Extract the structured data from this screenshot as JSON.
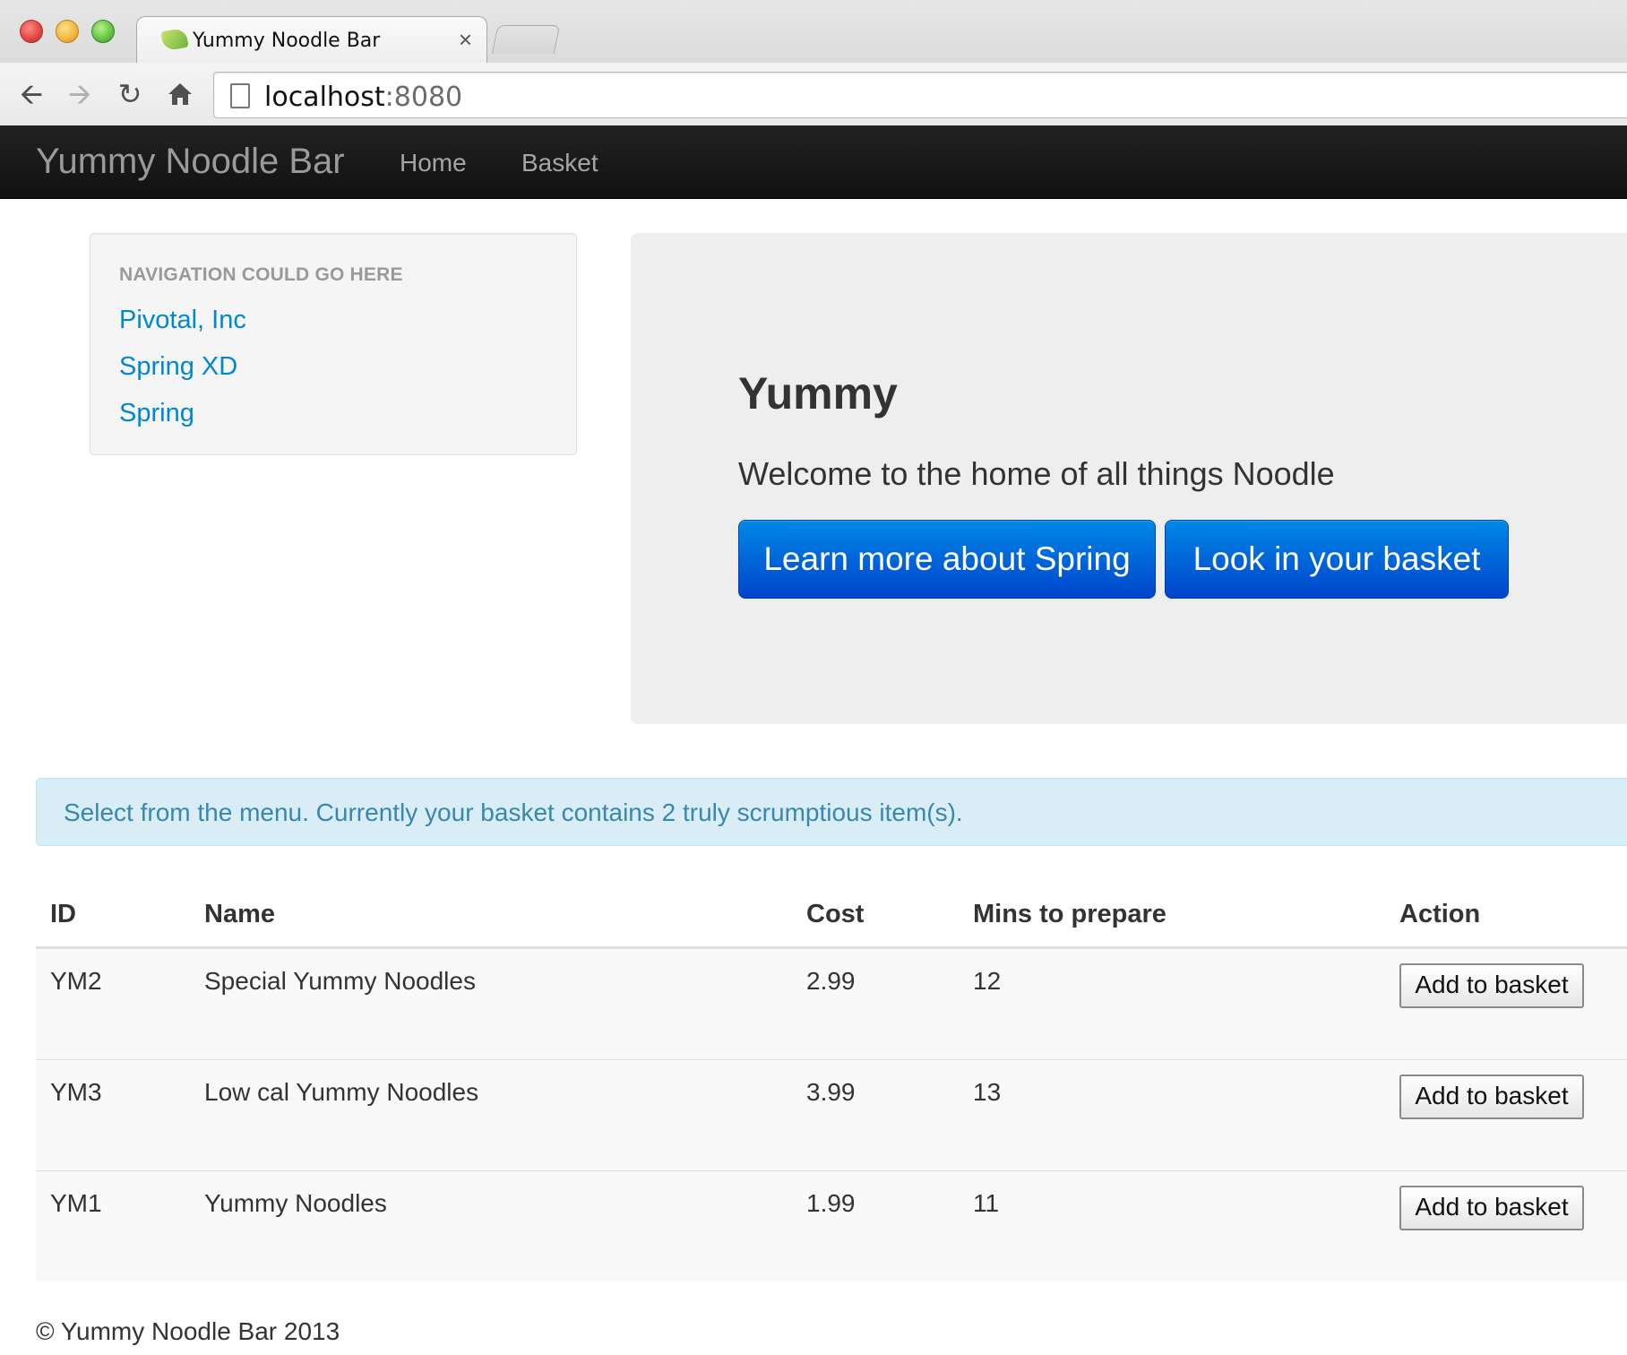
{
  "browser": {
    "tab_title": "Yummy Noodle Bar",
    "tab_close": "×",
    "url_host": "localhost",
    "url_port": ":8080"
  },
  "icons": {
    "back": "back-arrow-icon",
    "forward": "forward-arrow-icon",
    "reload": "reload-icon",
    "home": "home-icon",
    "page": "page-icon",
    "favicon": "spring-leaf-icon"
  },
  "navbar": {
    "brand": "Yummy Noodle Bar",
    "links": [
      "Home",
      "Basket"
    ]
  },
  "sidebar": {
    "header": "NAVIGATION COULD GO HERE",
    "links": [
      "Pivotal, Inc",
      "Spring XD",
      "Spring"
    ]
  },
  "hero": {
    "title": "Yummy",
    "subtitle": "Welcome to the home of all things Noodle",
    "buttons": [
      "Learn more about Spring",
      "Look in your basket"
    ]
  },
  "alert": {
    "text": "Select from the menu. Currently your basket contains 2 truly scrumptious item(s)."
  },
  "table": {
    "headers": [
      "ID",
      "Name",
      "Cost",
      "Mins to prepare",
      "Action"
    ],
    "rows": [
      {
        "id": "YM2",
        "name": "Special Yummy Noodles",
        "cost": "2.99",
        "mins": "12",
        "action": "Add to basket"
      },
      {
        "id": "YM3",
        "name": "Low cal Yummy Noodles",
        "cost": "3.99",
        "mins": "13",
        "action": "Add to basket"
      },
      {
        "id": "YM1",
        "name": "Yummy Noodles",
        "cost": "1.99",
        "mins": "11",
        "action": "Add to basket"
      }
    ]
  },
  "footer": {
    "text": "© Yummy Noodle Bar 2013"
  },
  "colors": {
    "navbar_bg": "#1b1b1b",
    "link": "#0088cc",
    "primary_button": "#0055dd",
    "alert_bg": "#d9edf7",
    "alert_text": "#3a87ad",
    "hero_bg": "#eeeeee"
  }
}
